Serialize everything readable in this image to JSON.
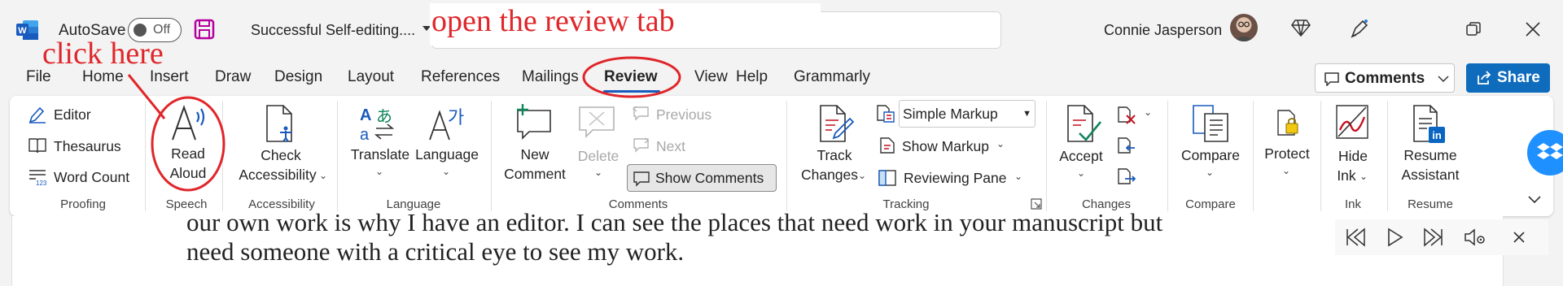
{
  "titlebar": {
    "autosave_label": "AutoSave",
    "autosave_state": "Off",
    "document_title": "Successful Self-editing....",
    "user_name": "Connie Jasperson"
  },
  "menu": {
    "tabs": [
      "File",
      "Home",
      "Insert",
      "Draw",
      "Design",
      "Layout",
      "References",
      "Mailings",
      "Review",
      "View",
      "Help",
      "Grammarly"
    ],
    "active_tab": "Review",
    "comments_label": "Comments",
    "share_label": "Share"
  },
  "ribbon": {
    "proofing": {
      "editor": "Editor",
      "thesaurus": "Thesaurus",
      "word_count": "Word Count",
      "group": "Proofing"
    },
    "speech": {
      "read": "Read",
      "aloud": "Aloud",
      "group": "Speech"
    },
    "accessibility": {
      "check": "Check",
      "accessibility": "Accessibility",
      "group": "Accessibility"
    },
    "language": {
      "translate": "Translate",
      "language": "Language",
      "group": "Language"
    },
    "comments": {
      "new": "New",
      "comment": "Comment",
      "delete": "Delete",
      "previous": "Previous",
      "next": "Next",
      "show_comments": "Show Comments",
      "group": "Comments"
    },
    "tracking": {
      "track": "Track",
      "changes": "Changes",
      "markup_select": "Simple Markup",
      "show_markup": "Show Markup",
      "reviewing_pane": "Reviewing Pane",
      "group": "Tracking"
    },
    "changes": {
      "accept": "Accept",
      "group": "Changes"
    },
    "compare": {
      "compare": "Compare",
      "group": "Compare"
    },
    "protect": {
      "protect": "Protect"
    },
    "ink": {
      "hide": "Hide",
      "ink": "Ink",
      "group": "Ink"
    },
    "resume": {
      "resume": "Resume",
      "assistant": "Assistant",
      "group": "Resume"
    }
  },
  "document": {
    "line1": "our own work is why I have an editor. I can see the places that need work in your manuscript but",
    "line2": "need someone with a critical eye to see my work."
  },
  "annotations": {
    "open_review": "open the review tab",
    "click_here": "click here"
  },
  "colors": {
    "accent": "#185abd",
    "share": "#0f6cbd",
    "annotation": "#e0262a",
    "word_blue": "#185abd"
  }
}
